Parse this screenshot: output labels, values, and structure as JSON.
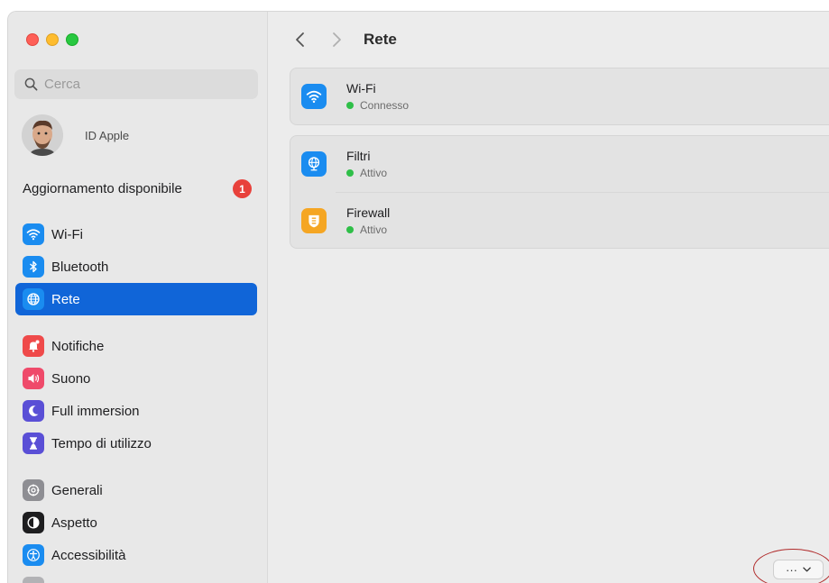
{
  "window": {
    "traffic_lights": [
      "close",
      "minimize",
      "zoom"
    ]
  },
  "sidebar": {
    "search_placeholder": "Cerca",
    "account_label": "ID Apple",
    "update_label": "Aggiornamento disponibile",
    "update_badge": "1",
    "groups": [
      [
        {
          "label": "Wi-Fi",
          "icon": "wifi-icon",
          "color": "#1a8cf0"
        },
        {
          "label": "Bluetooth",
          "icon": "bluetooth-icon",
          "color": "#1a8cf0"
        },
        {
          "label": "Rete",
          "icon": "globe-icon",
          "color": "#1a8cf0",
          "active": true
        }
      ],
      [
        {
          "label": "Notifiche",
          "icon": "bell-icon",
          "color": "#ef4a4a"
        },
        {
          "label": "Suono",
          "icon": "speaker-icon",
          "color": "#ef4a6a"
        },
        {
          "label": "Full immersion",
          "icon": "moon-icon",
          "color": "#5a4fd6"
        },
        {
          "label": "Tempo di utilizzo",
          "icon": "hourglass-icon",
          "color": "#5a4fd6"
        }
      ],
      [
        {
          "label": "Generali",
          "icon": "gear-icon",
          "color": "#8e8e93"
        },
        {
          "label": "Aspetto",
          "icon": "appearance-icon",
          "color": "#1d1d1f"
        },
        {
          "label": "Accessibilità",
          "icon": "accessibility-icon",
          "color": "#1a8cf0"
        }
      ]
    ]
  },
  "toolbar": {
    "title": "Rete"
  },
  "main": {
    "card1": [
      {
        "title": "Wi-Fi",
        "status": "Connesso",
        "icon": "wifi-icon",
        "color": "#1a8cf0"
      }
    ],
    "card2": [
      {
        "title": "Filtri",
        "status": "Attivo",
        "icon": "filter-globe-icon",
        "color": "#1a8cf0"
      },
      {
        "title": "Firewall",
        "status": "Attivo",
        "icon": "firewall-icon",
        "color": "#f5a623"
      }
    ],
    "more_label": "···"
  }
}
